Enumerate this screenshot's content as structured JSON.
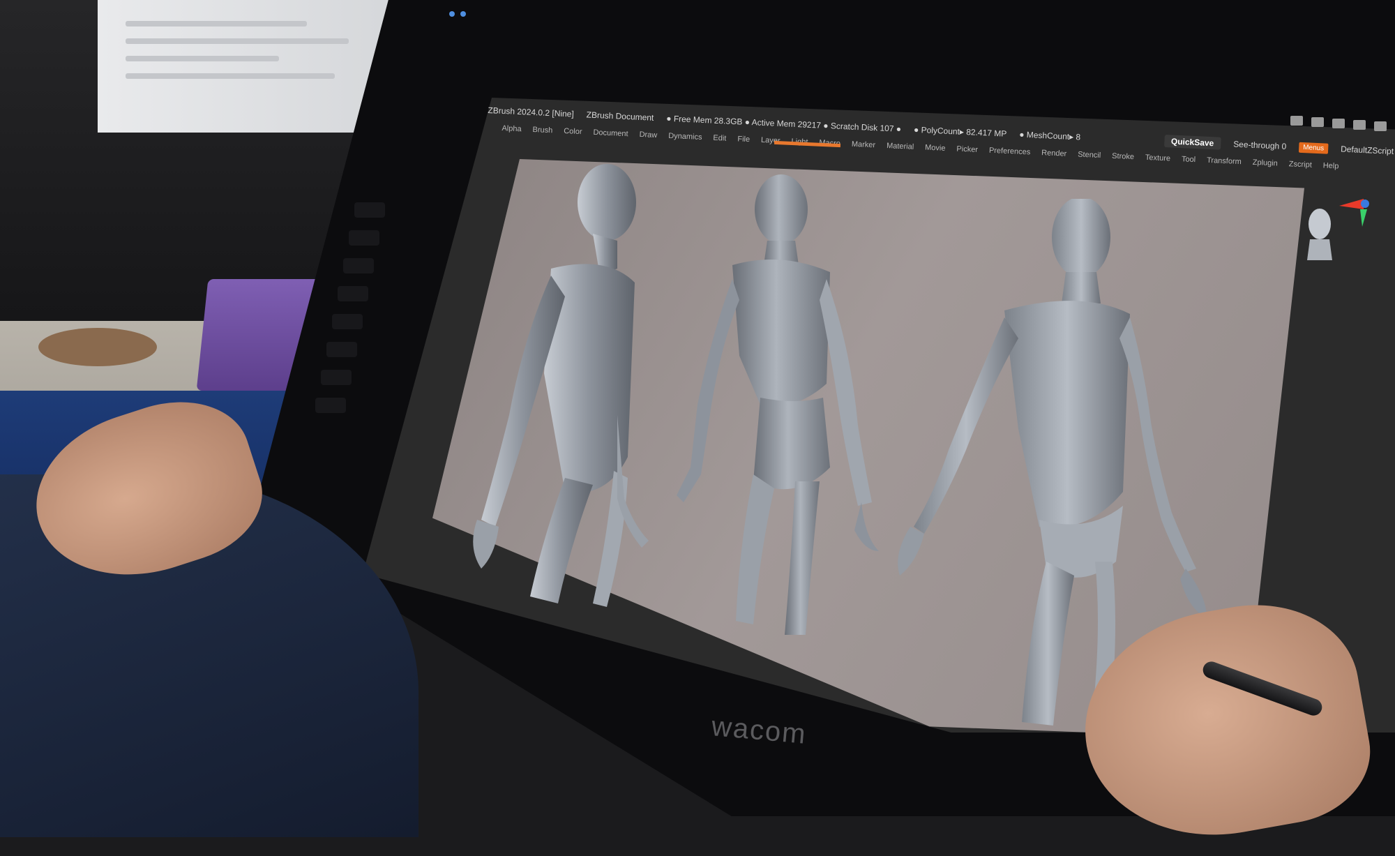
{
  "titlebar": {
    "app": "ZBrush 2024.0.2 [Nine]",
    "document": "ZBrush Document",
    "stats": "● Free Mem 28.3GB ● Active Mem 29217 ● Scratch Disk 107 ●",
    "polycount": "● PolyCount▸ 82.417 MP",
    "meshcount": "● MeshCount▸ 8",
    "quicksave": "QuickSave",
    "see_through": "See-through 0",
    "menus_tag": "Menus",
    "script": "DefaultZScript"
  },
  "menubar": {
    "items": [
      "Alpha",
      "Brush",
      "Color",
      "Document",
      "Draw",
      "Dynamics",
      "Edit",
      "File",
      "Layer",
      "Light",
      "Macro",
      "Marker",
      "Material",
      "Movie",
      "Picker",
      "Preferences",
      "Render",
      "Stencil",
      "Stroke",
      "Texture",
      "Tool",
      "Transform",
      "Zplugin",
      "Zscript",
      "Help"
    ]
  },
  "status": {
    "message": ""
  },
  "device": {
    "brand": "wacom"
  },
  "colors": {
    "accent": "#e8782e",
    "canvas": "#a29998",
    "model": "#8a9099"
  },
  "icons": [
    "navigation-cube-icon",
    "bust-thumbnail-icon",
    "toolbar-icon"
  ]
}
